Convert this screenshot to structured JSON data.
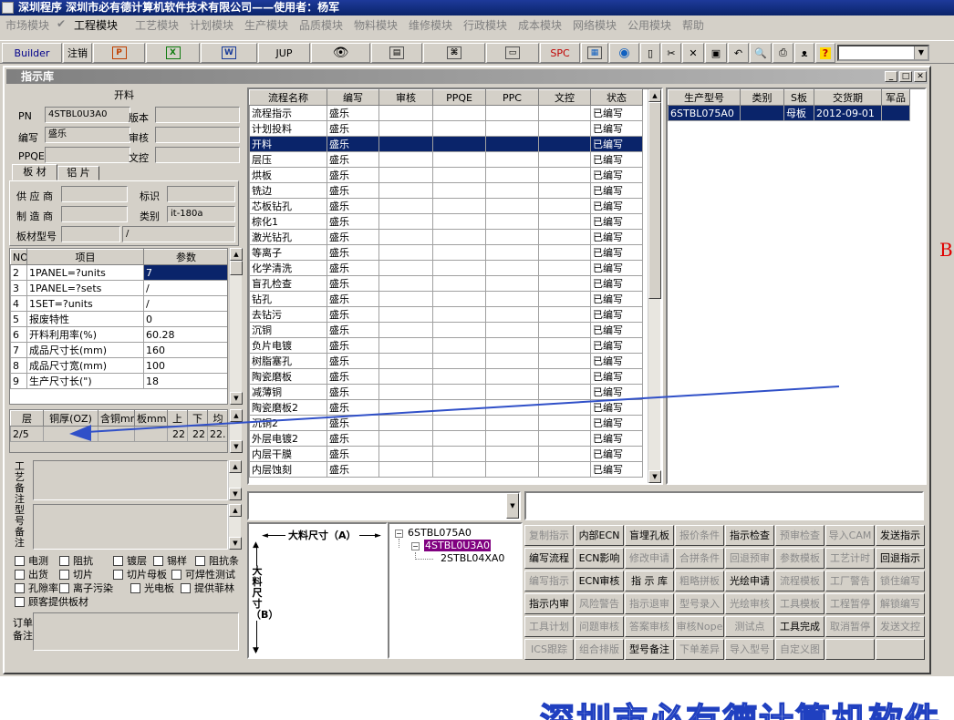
{
  "app": {
    "title": "深圳程序   深圳市必有德计算机软件技术有限公司——使用者：杨军"
  },
  "menu": [
    "市场模块",
    "✔",
    "工程模块",
    "工艺模块",
    "计划模块",
    "生产模块",
    "品质模块",
    "物料模块",
    "维修模块",
    "行政模块",
    "成本模块",
    "网络模块",
    "公用模块",
    "帮助"
  ],
  "toolbar": {
    "builder": "Builder",
    "logout": "注销",
    "jup": "JUP",
    "spc": "SPC"
  },
  "window": {
    "title": "指示库"
  },
  "left": {
    "section": "开料",
    "pn_label": "PN",
    "pn": "4STBL0U3A0",
    "version_label": "版本",
    "author_label": "编写",
    "author": "盛乐",
    "review_label": "审核",
    "ppqe_label": "PPQE",
    "dcc_label": "文控",
    "tab_board": "板 材",
    "tab_foil": "铝 片",
    "supplier_label": "供 应 商",
    "mark_label": "标识",
    "maker_label": "制 造 商",
    "type_label": "类别",
    "type": "it-180a",
    "model_label": "板材型号",
    "model_val": "/",
    "param_headers": [
      "NO",
      "项目",
      "参数"
    ],
    "params": [
      [
        "2",
        "1PANEL=?units",
        "7"
      ],
      [
        "3",
        "1PANEL=?sets",
        "/"
      ],
      [
        "4",
        "1SET=?units",
        "/"
      ],
      [
        "5",
        "报废特性",
        "0"
      ],
      [
        "6",
        "开料利用率(%)",
        "60.28"
      ],
      [
        "7",
        "成品尺寸长(mm)",
        "160"
      ],
      [
        "8",
        "成品尺寸宽(mm)",
        "100"
      ],
      [
        "9",
        "生产尺寸长(\")",
        "18"
      ]
    ],
    "layer_headers": [
      "层",
      "铜厚(OZ)",
      "含铜mm",
      "板mm",
      "上",
      "下",
      "均"
    ],
    "layer_row": [
      "2/5",
      "",
      "",
      "",
      "22",
      "22",
      "22."
    ],
    "note1_label": "工艺备注",
    "note2_label": "型号备注",
    "checks": [
      "电测",
      "阻抗",
      "镀层",
      "锡样",
      "阻抗条",
      "出货",
      "切片",
      "切片母板",
      "可焊性测试",
      "孔隙率",
      "离子污染",
      "光电板",
      "提供菲林",
      "顾客提供板材"
    ],
    "order_note_label": "订单备注"
  },
  "flow": {
    "headers": [
      "流程名称",
      "编写",
      "审核",
      "PPQE",
      "PPC",
      "文控",
      "状态"
    ],
    "rows": [
      [
        "流程指示",
        "盛乐",
        "已编写"
      ],
      [
        "计划投料",
        "盛乐",
        "已编写"
      ],
      [
        "开料",
        "盛乐",
        "已编写"
      ],
      [
        "层压",
        "盛乐",
        "已编写"
      ],
      [
        "烘板",
        "盛乐",
        "已编写"
      ],
      [
        "铣边",
        "盛乐",
        "已编写"
      ],
      [
        "芯板钻孔",
        "盛乐",
        "已编写"
      ],
      [
        "棕化1",
        "盛乐",
        "已编写"
      ],
      [
        "激光钻孔",
        "盛乐",
        "已编写"
      ],
      [
        "等离子",
        "盛乐",
        "已编写"
      ],
      [
        "化学清洗",
        "盛乐",
        "已编写"
      ],
      [
        "盲孔检查",
        "盛乐",
        "已编写"
      ],
      [
        "钻孔",
        "盛乐",
        "已编写"
      ],
      [
        "去钻污",
        "盛乐",
        "已编写"
      ],
      [
        "沉铜",
        "盛乐",
        "已编写"
      ],
      [
        "负片电镀",
        "盛乐",
        "已编写"
      ],
      [
        "树脂塞孔",
        "盛乐",
        "已编写"
      ],
      [
        "陶瓷磨板",
        "盛乐",
        "已编写"
      ],
      [
        "减薄铜",
        "盛乐",
        "已编写"
      ],
      [
        "陶瓷磨板2",
        "盛乐",
        "已编写"
      ],
      [
        "沉铜2",
        "盛乐",
        "已编写"
      ],
      [
        "外层电镀2",
        "盛乐",
        "已编写"
      ],
      [
        "内层干膜",
        "盛乐",
        "已编写"
      ],
      [
        "内层蚀刻",
        "盛乐",
        "已编写"
      ]
    ],
    "selected_index": 2
  },
  "prod": {
    "headers": [
      "生产型号",
      "类别",
      "S板",
      "交货期",
      "军品"
    ],
    "row": [
      "6STBL075A0",
      "",
      "母板",
      "2012-09-01",
      ""
    ]
  },
  "size": {
    "a_label": "大料尺寸（A）",
    "b_label": "大料尺寸（B）"
  },
  "tree": [
    "6STBL075A0",
    "4STBL0U3A0",
    "2STBL04XA0"
  ],
  "buttons": [
    [
      "复制指示",
      true
    ],
    [
      "内部ECN",
      false
    ],
    [
      "盲埋孔板",
      false
    ],
    [
      "报价条件",
      true
    ],
    [
      "指示检查",
      false
    ],
    [
      "预审检查",
      true
    ],
    [
      "导入CAM",
      true
    ],
    [
      "发送指示",
      false
    ],
    [
      "编写流程",
      false
    ],
    [
      "ECN影响",
      false
    ],
    [
      "修改申请",
      true
    ],
    [
      "合拼条件",
      true
    ],
    [
      "回退预审",
      true
    ],
    [
      "参数模板",
      true
    ],
    [
      "工艺计时",
      true
    ],
    [
      "回退指示",
      false
    ],
    [
      "编写指示",
      true
    ],
    [
      "ECN审核",
      false
    ],
    [
      "指 示 库",
      false
    ],
    [
      "粗略拼板",
      true
    ],
    [
      "光绘申请",
      false
    ],
    [
      "流程模板",
      true
    ],
    [
      "工厂警告",
      true
    ],
    [
      "锁住编写",
      true
    ],
    [
      "指示内审",
      false
    ],
    [
      "风险警告",
      true
    ],
    [
      "指示退审",
      true
    ],
    [
      "型号录入",
      true
    ],
    [
      "光绘审核",
      true
    ],
    [
      "工具模板",
      true
    ],
    [
      "工程暂停",
      true
    ],
    [
      "解锁编写",
      true
    ],
    [
      "工具计划",
      true
    ],
    [
      "问题审核",
      true
    ],
    [
      "答案审核",
      true
    ],
    [
      "审核Nope",
      true
    ],
    [
      "测试点",
      true
    ],
    [
      "工具完成",
      false
    ],
    [
      "取消暂停",
      true
    ],
    [
      "发送文控",
      true
    ],
    [
      "ICS跟踪",
      true
    ],
    [
      "组合排版",
      true
    ],
    [
      "型号备注",
      false
    ],
    [
      "下单差异",
      true
    ],
    [
      "导入型号",
      true
    ],
    [
      "自定义图",
      true
    ],
    [
      "",
      true
    ],
    [
      "",
      true
    ]
  ],
  "watermark": "深圳市必有德计算机软件",
  "side_letter": "B"
}
